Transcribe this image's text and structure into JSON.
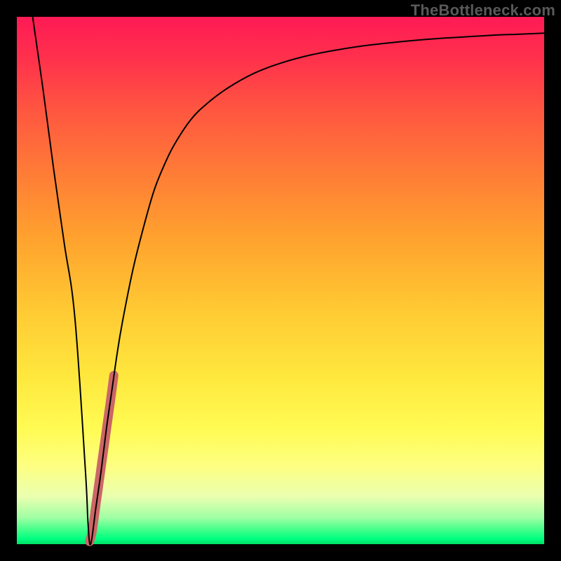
{
  "watermark": "TheBottleneck.com",
  "colors": {
    "curve": "#000000",
    "highlight": "#cc6666",
    "frame": "#000000"
  },
  "chart_data": {
    "type": "line",
    "title": "",
    "subtitle": "",
    "xlabel": "",
    "ylabel": "",
    "xlim": [
      0,
      100
    ],
    "ylim": [
      0,
      100
    ],
    "grid": false,
    "legend": false,
    "annotations": [],
    "series": [
      {
        "name": "bottleneck-curve",
        "role": "main",
        "stroke_width": 2,
        "x": [
          3,
          5,
          7,
          9,
          11,
          13,
          13.5,
          14,
          15,
          16,
          17,
          18,
          19,
          20,
          22,
          24,
          26,
          28,
          30,
          33,
          36,
          40,
          45,
          50,
          55,
          60,
          65,
          70,
          75,
          80,
          85,
          90,
          95,
          100
        ],
        "y": [
          100,
          86,
          71,
          57,
          43,
          14,
          4,
          0,
          7,
          14,
          22,
          29,
          36,
          42,
          52,
          60,
          67,
          72,
          76,
          80.5,
          83.5,
          86.5,
          89.3,
          91.2,
          92.6,
          93.6,
          94.4,
          95,
          95.5,
          95.9,
          96.2,
          96.5,
          96.7,
          96.9
        ]
      },
      {
        "name": "highlight-strip",
        "role": "highlight",
        "stroke_width": 13,
        "x": [
          13.8,
          14.3,
          15.0,
          15.7,
          16.4,
          17.1,
          17.8,
          18.4
        ],
        "y": [
          0.5,
          2.5,
          7.5,
          12.5,
          17.5,
          22.5,
          27.5,
          32.0
        ]
      }
    ]
  }
}
